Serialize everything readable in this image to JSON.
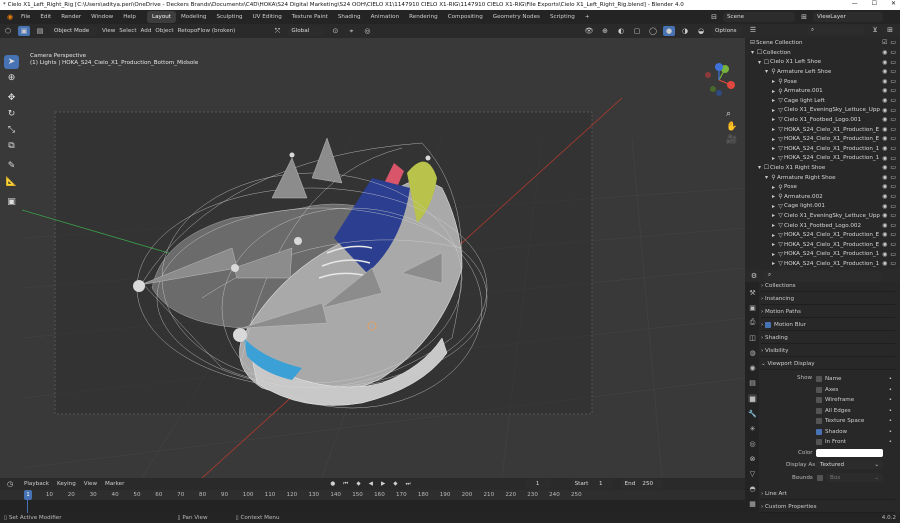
{
  "window": {
    "title": "* Cielo X1_Left_Right_Rig [C:\\Users\\aditya.peri\\OneDrive - Deckers Brands\\Documents\\C4D\\HOKA\\S24 Digital Marketing\\S24 OOH\\CIELO X1\\1147910 CIELO X1-RIG\\1147910 CIELO X1-RIG\\File Exports\\Cielo X1_Left_Right_Rig.blend] - Blender 4.0",
    "minimize": "—",
    "maximize": "☐",
    "close": "✕"
  },
  "menu": {
    "items": [
      "File",
      "Edit",
      "Render",
      "Window",
      "Help"
    ],
    "workspaces": [
      "Layout",
      "Modeling",
      "Sculpting",
      "UV Editing",
      "Texture Paint",
      "Shading",
      "Animation",
      "Rendering",
      "Compositing",
      "Geometry Nodes",
      "Scripting"
    ],
    "add_tab": "+",
    "scene_label": "Scene",
    "viewlayer_label": "ViewLayer"
  },
  "viewport_header": {
    "mode": "Object Mode",
    "menus": [
      "View",
      "Select",
      "Add",
      "Object",
      "RetopoFlow (broken)"
    ],
    "transform": "Global",
    "options": "Options"
  },
  "viewport": {
    "view_name": "Camera Perspective",
    "context": "(1) Lights | HOKA_S24_Cielo_X1_Production_Bottom_Midsole",
    "gizmo": {
      "x": "X",
      "y": "Y",
      "z": "Z"
    }
  },
  "outliner": {
    "title": "Scene Collection",
    "rows": [
      {
        "label": "Collection",
        "indent": 0,
        "icon": "☐"
      },
      {
        "label": "Cielo X1 Left Shoe",
        "indent": 1,
        "icon": "☐"
      },
      {
        "label": "Armature Left Shoe",
        "indent": 2,
        "icon": "⚲"
      },
      {
        "label": "Pose",
        "indent": 3,
        "icon": "⚲"
      },
      {
        "label": "Armature.001",
        "indent": 3,
        "icon": "⚲"
      },
      {
        "label": "Cage light Left",
        "indent": 3,
        "icon": "▽"
      },
      {
        "label": "Cielo X1_EveningSky_Lettuce_Upp",
        "indent": 3,
        "icon": "▽"
      },
      {
        "label": "Cielo X1_Footbed_Logo.001",
        "indent": 3,
        "icon": "▽"
      },
      {
        "label": "HOKA_S24_Cielo_X1_Production_E",
        "indent": 3,
        "icon": "▽"
      },
      {
        "label": "HOKA_S24_Cielo_X1_Production_E",
        "indent": 3,
        "icon": "▽"
      },
      {
        "label": "HOKA_S24_Cielo_X1_Production_1",
        "indent": 3,
        "icon": "▽"
      },
      {
        "label": "HOKA_S24_Cielo_X1_Production_1",
        "indent": 3,
        "icon": "▽"
      },
      {
        "label": "Cielo X1 Right Shoe",
        "indent": 1,
        "icon": "☐"
      },
      {
        "label": "Armature Right Shoe",
        "indent": 2,
        "icon": "⚲"
      },
      {
        "label": "Pose",
        "indent": 3,
        "icon": "⚲"
      },
      {
        "label": "Armature.002",
        "indent": 3,
        "icon": "⚲"
      },
      {
        "label": "Cage light.001",
        "indent": 3,
        "icon": "▽"
      },
      {
        "label": "Cielo X1_EveningSky_Lettuce_Upp",
        "indent": 3,
        "icon": "▽"
      },
      {
        "label": "Cielo X1_Footbed_Logo.002",
        "indent": 3,
        "icon": "▽"
      },
      {
        "label": "HOKA_S24_Cielo_X1_Production_E",
        "indent": 3,
        "icon": "▽"
      },
      {
        "label": "HOKA_S24_Cielo_X1_Production_E",
        "indent": 3,
        "icon": "▽"
      },
      {
        "label": "HOKA_S24_Cielo_X1_Production_1",
        "indent": 3,
        "icon": "▽"
      },
      {
        "label": "HOKA_S24_Cielo_X1_Production_1",
        "indent": 3,
        "icon": "▽"
      },
      {
        "label": "HOKA_S24_Cielo_X1_Production_1",
        "indent": 3,
        "icon": "▽"
      }
    ]
  },
  "properties": {
    "sections_top": [
      "Collections",
      "Instancing",
      "Motion Paths",
      "Motion Blur",
      "Shading",
      "Visibility"
    ],
    "viewport_display": "Viewport Display",
    "show_label": "Show",
    "show_items": [
      {
        "label": "Name",
        "on": false
      },
      {
        "label": "Axes",
        "on": false
      },
      {
        "label": "Wireframe",
        "on": false
      },
      {
        "label": "All Edges",
        "on": false
      },
      {
        "label": "Texture Space",
        "on": false
      },
      {
        "label": "Shadow",
        "on": true
      },
      {
        "label": "In Front",
        "on": false
      }
    ],
    "color_label": "Color",
    "display_as_label": "Display As",
    "display_as_value": "Textured",
    "bounds_label": "Bounds",
    "bounds_value": "Box",
    "sections_bottom": [
      "Line Art",
      "Custom Properties"
    ]
  },
  "timeline": {
    "menus": [
      "Playback",
      "Keying",
      "View",
      "Marker"
    ],
    "current_frame": "1",
    "start_label": "Start",
    "start": "1",
    "end_label": "End",
    "end": "250",
    "ticks": [
      "0",
      "10",
      "20",
      "30",
      "40",
      "50",
      "60",
      "70",
      "80",
      "90",
      "100",
      "110",
      "120",
      "130",
      "140",
      "150",
      "160",
      "170",
      "180",
      "190",
      "200",
      "210",
      "220",
      "230",
      "240",
      "250"
    ]
  },
  "status": {
    "items": [
      "Set Active Modifier",
      "Pan View",
      "Context Menu"
    ],
    "version": "4.0.2"
  },
  "colors": {
    "accent": "#4772b3",
    "viewport_bg": "#393939",
    "x_axis": "#c0392b",
    "y_axis": "#3aa14a"
  }
}
